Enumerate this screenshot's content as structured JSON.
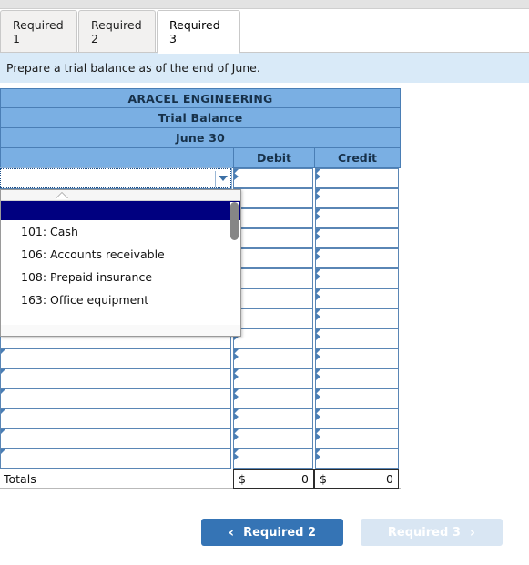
{
  "tabs": [
    {
      "label": "Required 1",
      "active": false
    },
    {
      "label": "Required 2",
      "active": false
    },
    {
      "label": "Required 3",
      "active": true
    }
  ],
  "instruction": "Prepare a trial balance as of the end of June.",
  "worksheet": {
    "company": "ARACEL ENGINEERING",
    "statement": "Trial Balance",
    "period": "June 30",
    "columns": {
      "account": "",
      "debit": "Debit",
      "credit": "Credit"
    },
    "rows": [
      {
        "account": "",
        "debit": "",
        "credit": ""
      },
      {
        "account": "",
        "debit": "",
        "credit": ""
      },
      {
        "account": "",
        "debit": "",
        "credit": ""
      },
      {
        "account": "",
        "debit": "",
        "credit": ""
      },
      {
        "account": "",
        "debit": "",
        "credit": ""
      },
      {
        "account": "",
        "debit": "",
        "credit": ""
      },
      {
        "account": "",
        "debit": "",
        "credit": ""
      },
      {
        "account": "",
        "debit": "",
        "credit": ""
      },
      {
        "account": "",
        "debit": "",
        "credit": ""
      },
      {
        "account": "",
        "debit": "",
        "credit": ""
      },
      {
        "account": "",
        "debit": "",
        "credit": ""
      },
      {
        "account": "",
        "debit": "",
        "credit": ""
      },
      {
        "account": "",
        "debit": "",
        "credit": ""
      },
      {
        "account": "",
        "debit": "",
        "credit": ""
      },
      {
        "account": "",
        "debit": "",
        "credit": ""
      }
    ],
    "totals": {
      "label": "Totals",
      "debit_symbol": "$",
      "debit_value": "0",
      "credit_symbol": "$",
      "credit_value": "0"
    }
  },
  "account_dropdown": {
    "open": true,
    "selected_value": "",
    "options": [
      "",
      "101: Cash",
      "106: Accounts receivable",
      "108: Prepaid insurance",
      "163: Office equipment"
    ]
  },
  "nav": {
    "prev_label": "Required 2",
    "prev_chevron": "‹",
    "next_label": "Required 3",
    "next_chevron": "›"
  },
  "colors": {
    "header_blue": "#7aafe3",
    "grid_blue": "#5a86b5",
    "instruction_blue": "#d9eaf8",
    "button_blue": "#3574b5",
    "button_disabled": "#d9e6f3",
    "dropdown_selected": "#000080"
  }
}
